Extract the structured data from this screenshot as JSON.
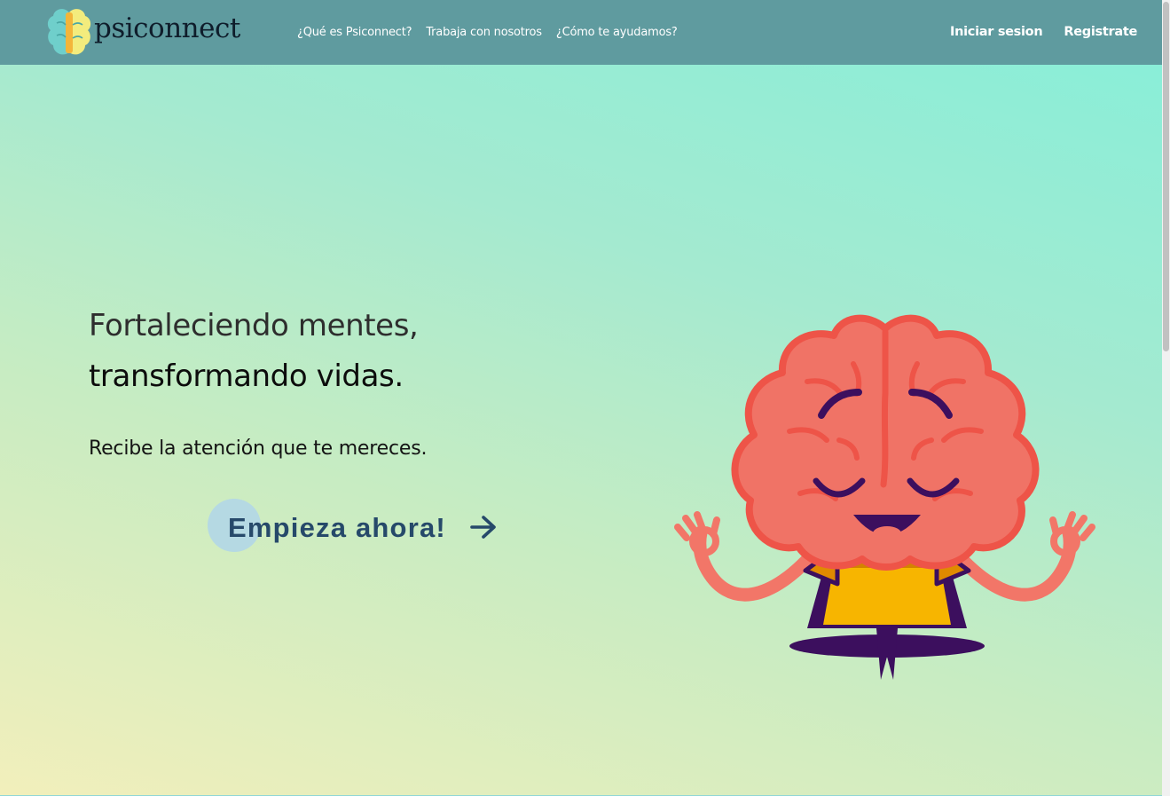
{
  "header": {
    "logo_text": "psiconnect",
    "nav": [
      {
        "label": "¿Qué es Psiconnect?"
      },
      {
        "label": "Trabaja con nosotros"
      },
      {
        "label": "¿Cómo te ayudamos?"
      }
    ],
    "auth": {
      "login_label": "Iniciar sesion",
      "register_label": "Registrate"
    }
  },
  "hero": {
    "headline_line1": "Fortaleciendo mentes,",
    "headline_line2": "transformando vidas.",
    "subtitle": "Recibe la atención que te mereces.",
    "cta_label": "Empieza ahora!",
    "cta_icon": "arrow-right-icon",
    "illustration": "meditating-brain-illustration"
  },
  "colors": {
    "nav_bg": "#5f9b9f",
    "hero_gradient_start": "#f2efbb",
    "hero_gradient_end": "#8aeed8",
    "cta_text": "#26496a",
    "cta_circle": "#b5d9e3"
  }
}
